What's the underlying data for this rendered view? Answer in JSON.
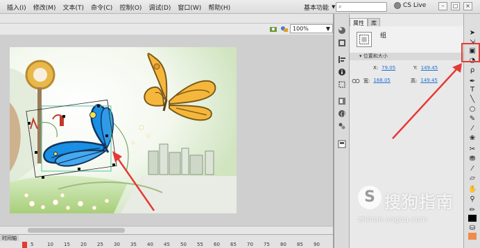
{
  "menubar": {
    "items": [
      "插入(I)",
      "修改(M)",
      "文本(T)",
      "命令(C)",
      "控制(O)",
      "调试(D)",
      "窗口(W)",
      "帮助(H)"
    ],
    "workspace": "基本功能",
    "cslive": "CS Live",
    "window_buttons": [
      "–",
      "□",
      "×"
    ]
  },
  "stage": {
    "zoom": "100%"
  },
  "timeline": {
    "tab": "时间轴",
    "frame_numbers": [
      "5",
      "10",
      "15",
      "20",
      "25",
      "30",
      "35",
      "40",
      "45",
      "50",
      "55",
      "60",
      "65",
      "70",
      "75",
      "80",
      "85",
      "90"
    ]
  },
  "properties": {
    "tabs": [
      "属性",
      "库"
    ],
    "object_type": "组",
    "section_title": "位置和大小",
    "x_label": "X:",
    "x_value": "79.05",
    "y_label": "Y:",
    "y_value": "149.45",
    "w_label": "宽:",
    "w_value": "168.05",
    "h_label": "高:",
    "h_value": "149.45"
  },
  "watermark": {
    "logo": "S",
    "title": "搜狗指南",
    "url": "zhinan.sogou.com"
  },
  "colors": {
    "annotation": "#e53935",
    "butterfly_blue": "#1a8fe3",
    "butterfly_orange": "#f5b73b",
    "selection_box": "#4fc3a1"
  },
  "icons": {
    "tools": [
      "selection-tool",
      "subselection-tool",
      "free-transform-tool",
      "3d-rotation-tool",
      "lasso-tool",
      "pen-tool",
      "text-tool",
      "line-tool",
      "rectangle-tool",
      "pencil-tool",
      "brush-tool",
      "deco-tool",
      "bone-tool",
      "paint-bucket-tool",
      "eyedropper-tool",
      "eraser-tool",
      "hand-tool",
      "zoom-tool",
      "stroke-color",
      "fill-color"
    ]
  }
}
